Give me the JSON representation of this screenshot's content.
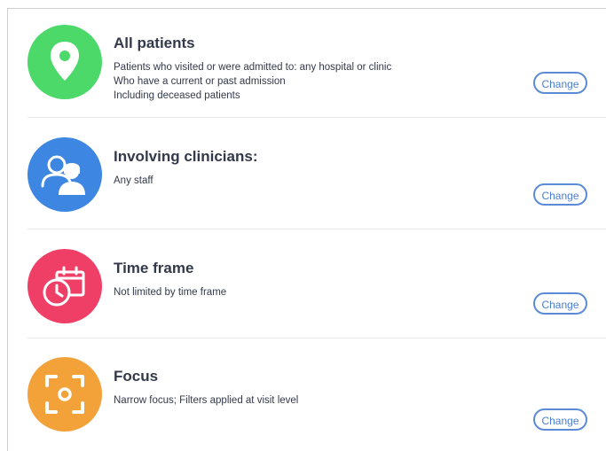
{
  "sections": [
    {
      "title": "All patients",
      "lines": [
        "Patients who visited or were admitted to: any hospital or clinic",
        "Who have a current or past admission",
        "Including deceased patients"
      ],
      "button": "Change",
      "icon": "location-pin-icon",
      "color": "#4cd96a"
    },
    {
      "title": "Involving clinicians:",
      "lines": [
        "Any staff"
      ],
      "button": "Change",
      "icon": "clinicians-icon",
      "color": "#3d86e2"
    },
    {
      "title": "Time frame",
      "lines": [
        "Not limited by time frame"
      ],
      "button": "Change",
      "icon": "calendar-clock-icon",
      "color": "#f03f67"
    },
    {
      "title": "Focus",
      "lines": [
        "Narrow focus; Filters applied at visit level"
      ],
      "button": "Change",
      "icon": "focus-target-icon",
      "color": "#f3a23a"
    }
  ]
}
